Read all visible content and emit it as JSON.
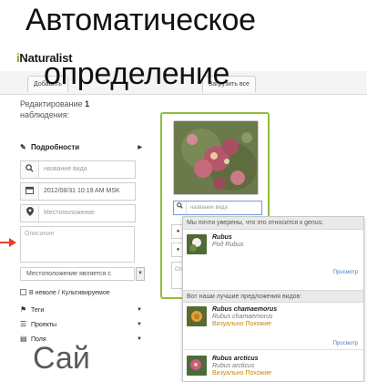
{
  "overlay": {
    "title_line1": "Автоматическое",
    "title_line2": "определение",
    "bottom_word": "Сай"
  },
  "app": {
    "brand_i": "i",
    "brand_rest": "Naturalist",
    "tab_left": "Добавить",
    "tab_right": "Загрузить все"
  },
  "edit": {
    "heading_prefix": "Редактирование",
    "heading_count": "1",
    "heading_suffix": "наблюдения:",
    "details_label": "Подробности",
    "species_placeholder": "название вида",
    "datetime_value": "2012/08/31 10:19 AM MSK",
    "location_placeholder": "Местоположение",
    "description_placeholder": "Описание",
    "location_visibility": "Местоположение является с",
    "captive_label": "В неволе / Культивируемое",
    "tags_label": "Теги",
    "projects_label": "Проекты",
    "fields_label": "Поля"
  },
  "card": {
    "species_input_placeholder": "название вида",
    "notes_placeholder": "Опи"
  },
  "suggestions": {
    "confident_header": "Мы почти уверены, что это относится к genus:",
    "top": {
      "scientific": "Rubus",
      "rank_text": "Род Rubus",
      "view_link": "Просмотр"
    },
    "best_header": "Вот наши лучшие предложения видов:",
    "items": [
      {
        "scientific": "Rubus chamaemorus",
        "sci2": "Rubus chamaemorus",
        "common": "Визуально Похожие",
        "view_link": "Просмотр"
      },
      {
        "scientific": "Rubus arcticus",
        "sci2": "Rubus arcticus",
        "common": "Визуально Похожие"
      }
    ]
  },
  "colors": {
    "accent_green": "#8fbf3a",
    "link_blue": "#4a7ed1",
    "arrow_red": "#e8402a"
  }
}
